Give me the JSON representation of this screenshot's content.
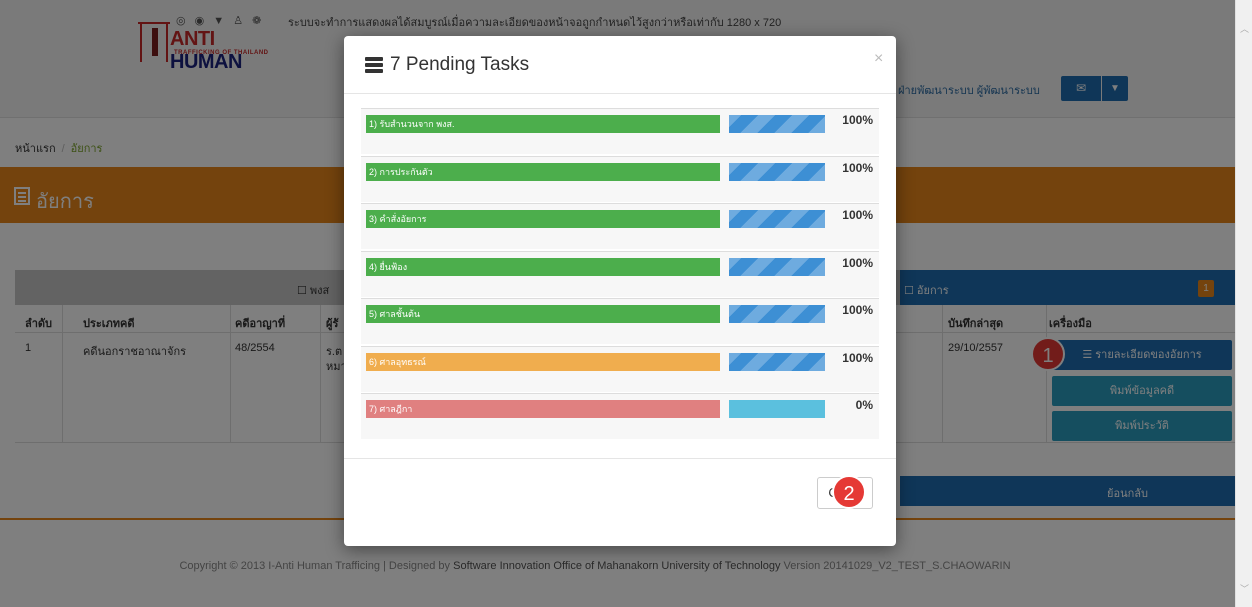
{
  "header": {
    "notice": "ระบบจะทำการแสดงผลได้สมบูรณ์เมื่อความละเอียดของหน้าจอถูกกำหนดไว้สูงกว่าหรือเท่ากับ 1280 x 720",
    "logo_line1": "ANTI",
    "logo_line2": "HUMAN",
    "logo_tagline": "TRAFFICKING OF THAILAND",
    "user_name": "ฝ่ายพัฒนาระบบ ผู้พัฒนาระบบ",
    "mail_icon": "envelope-icon",
    "caret_icon": "caret-down-icon"
  },
  "breadcrumb": {
    "home": "หน้าแรก",
    "separator": "/",
    "current": "อัยการ"
  },
  "page_title": "อัยการ",
  "table": {
    "group_left_label": "พงส",
    "group_right_label": "อัยการ",
    "group_right_badge": "1",
    "columns": {
      "order": "ลำดับ",
      "case_type": "ประเภทคดี",
      "case_number": "คดีอาญาที่",
      "responsible": "ผู้รั",
      "last_saved": "บันทึกล่าสุด",
      "tools": "เครื่องมือ"
    },
    "row": {
      "order": "1",
      "case_type": "คดีนอกราชอาณาจักร",
      "case_number": "48/2554",
      "responsible_1": "ร.ต",
      "responsible_2": "หมา",
      "last_saved": "29/10/2557"
    },
    "tools": {
      "details": "รายละเอียดของอัยการ",
      "print_case": "พิมพ์ข้อมูลคดี",
      "print_history": "พิมพ์ประวัติ"
    },
    "back": "ย้อนกลับ"
  },
  "footer": {
    "prefix": "Copyright © 2013 I-Anti Human Trafficing | Designed by ",
    "org": "Software Innovation Office of Mahanakorn University of Technology",
    "suffix": " Version 20141029_V2_TEST_S.CHAOWARIN"
  },
  "annotations": {
    "marker_1": "1",
    "marker_2": "2"
  },
  "modal": {
    "title": "7 Pending Tasks",
    "title_icon": "tasks-icon",
    "close_x": "×",
    "close_button": "Close",
    "tasks": [
      {
        "label": "1) รับสำนวนจาก พงส.",
        "color": "green",
        "progress": 100,
        "percent": "100%"
      },
      {
        "label": "2) การประกันตัว",
        "color": "green",
        "progress": 100,
        "percent": "100%"
      },
      {
        "label": "3) คำสั่งอัยการ",
        "color": "green",
        "progress": 100,
        "percent": "100%"
      },
      {
        "label": "4) ยื่นฟ้อง",
        "color": "green",
        "progress": 100,
        "percent": "100%"
      },
      {
        "label": "5) ศาลชั้นต้น",
        "color": "green",
        "progress": 100,
        "percent": "100%"
      },
      {
        "label": "6) ศาลอุทธรณ์",
        "color": "orange",
        "progress": 100,
        "percent": "100%"
      },
      {
        "label": "7) ศาลฎีกา",
        "color": "red",
        "progress": 0,
        "percent": "0%"
      }
    ]
  },
  "colors": {
    "accent_orange": "#e8861a",
    "primary_blue": "#1f6db0",
    "task_green": "#4cae4c",
    "task_orange": "#f0ad4e",
    "task_red": "#e08080"
  }
}
